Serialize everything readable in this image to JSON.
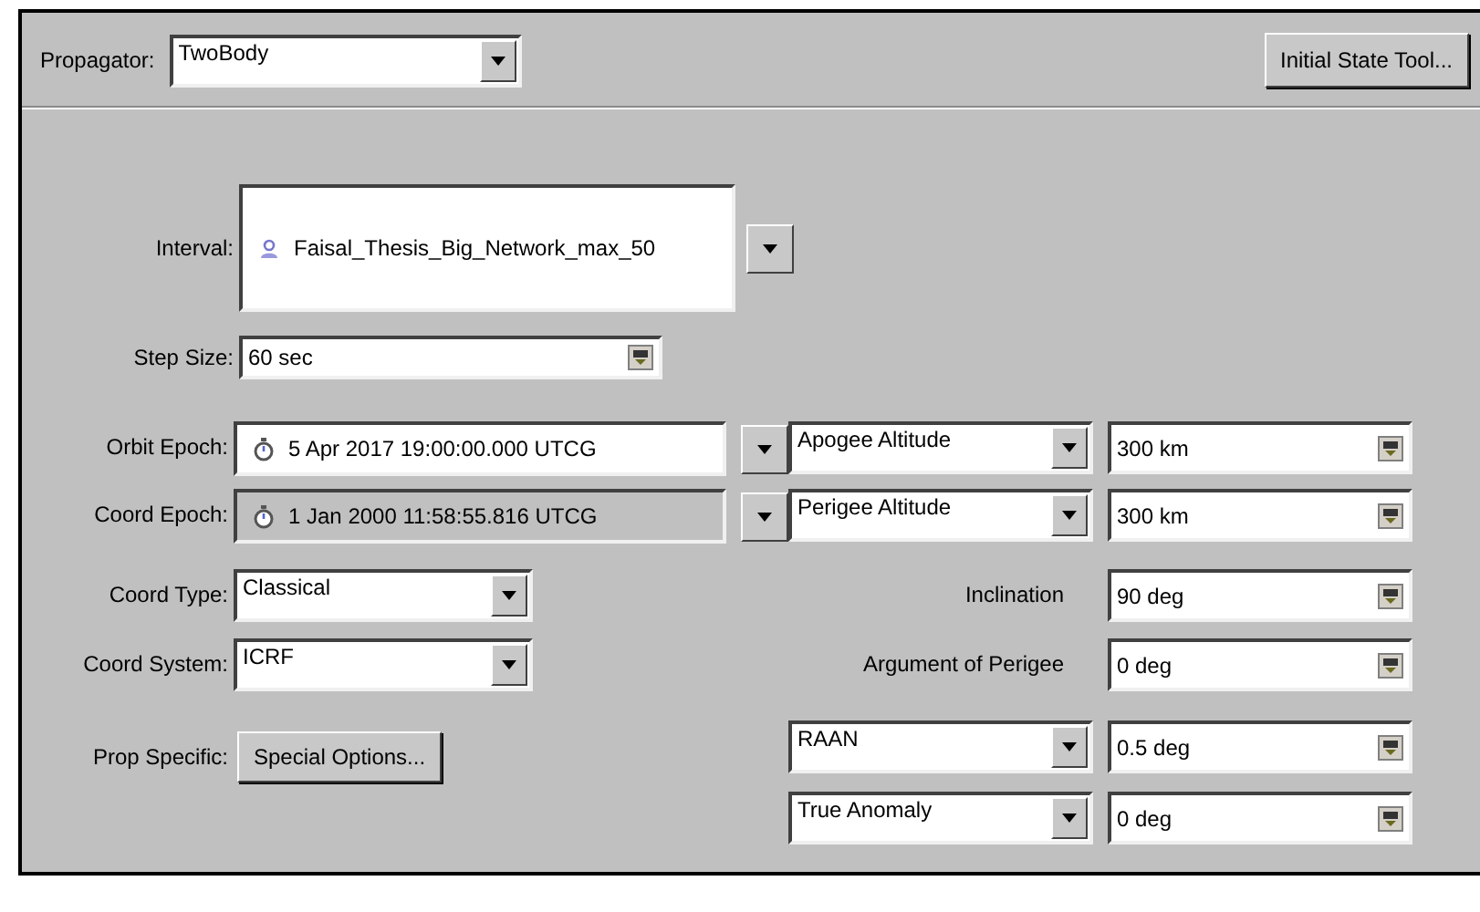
{
  "propagator": {
    "label": "Propagator:",
    "value": "TwoBody"
  },
  "initial_state_button": "Initial State Tool...",
  "interval": {
    "label": "Interval:",
    "value": "Faisal_Thesis_Big_Network_max_50"
  },
  "step_size": {
    "label": "Step Size:",
    "value": "60 sec"
  },
  "epochs": [
    {
      "label": "Orbit Epoch:",
      "value": "5 Apr 2017 19:00:00.000 UTCG",
      "disabled": false
    },
    {
      "label": "Coord Epoch:",
      "value": "1 Jan 2000 11:58:55.816 UTCG",
      "disabled": true
    }
  ],
  "coord_type": {
    "label": "Coord Type:",
    "value": "Classical"
  },
  "coord_system": {
    "label": "Coord System:",
    "value": "ICRF"
  },
  "prop_specific": {
    "label": "Prop Specific:",
    "button": "Special Options..."
  },
  "elements": [
    {
      "kind": "combo",
      "name": "Apogee Altitude",
      "value": "300 km"
    },
    {
      "kind": "combo",
      "name": "Perigee Altitude",
      "value": "300 km"
    },
    {
      "kind": "label",
      "name": "Inclination",
      "value": "90 deg"
    },
    {
      "kind": "label",
      "name": "Argument of Perigee",
      "value": "0 deg"
    },
    {
      "kind": "combo",
      "name": "RAAN",
      "value": "0.5 deg"
    },
    {
      "kind": "combo",
      "name": "True Anomaly",
      "value": "0 deg"
    }
  ]
}
